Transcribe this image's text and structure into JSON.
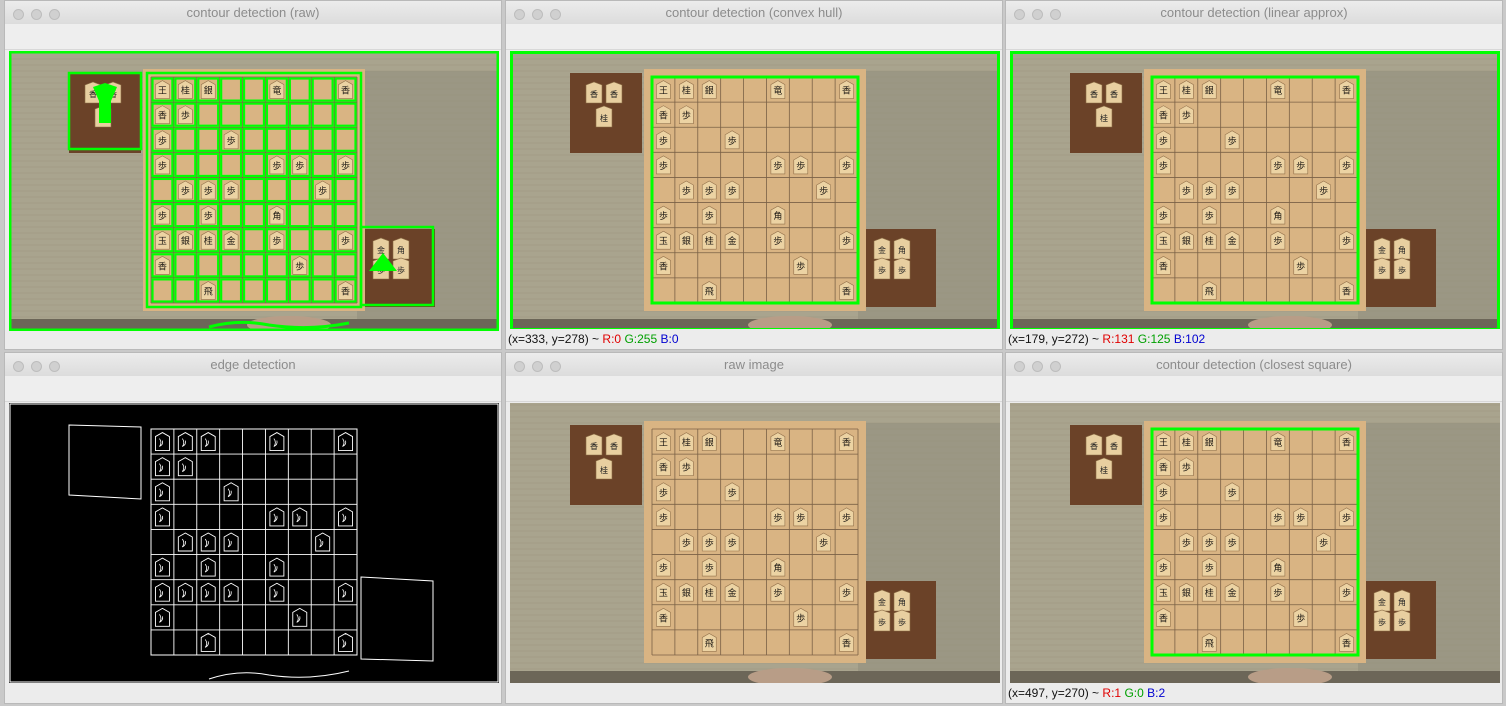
{
  "windows": {
    "raw_contour": {
      "title": "contour detection (raw)",
      "status": null
    },
    "convex_hull": {
      "title": "contour detection (convex hull)",
      "status": {
        "coords": "(x=333, y=278) ~",
        "r": "R:0",
        "g": "G:255",
        "b": "B:0"
      }
    },
    "linear_approx": {
      "title": "contour detection (linear approx)",
      "status": {
        "coords": "(x=179, y=272) ~",
        "r": "R:131",
        "g": "G:125",
        "b": "B:102"
      }
    },
    "edge": {
      "title": "edge detection",
      "status": null
    },
    "raw_image": {
      "title": "raw image",
      "status": null
    },
    "closest_square": {
      "title": "contour detection (closest square)",
      "status": {
        "coords": "(x=497, y=270) ~",
        "r": "R:1",
        "g": "G:0",
        "b": "B:2"
      }
    }
  },
  "board": {
    "pieces": [
      [
        "王",
        "桂",
        "銀",
        "",
        "",
        "竜",
        "",
        "",
        "香"
      ],
      [
        "香",
        "歩",
        "",
        "",
        "",
        "",
        "",
        "",
        ""
      ],
      [
        "歩",
        "",
        "",
        "歩",
        "",
        "",
        "",
        "",
        ""
      ],
      [
        "歩",
        "",
        "",
        "",
        "",
        "歩",
        "歩",
        "",
        "歩"
      ],
      [
        "",
        "歩",
        "歩",
        "歩",
        "",
        "",
        "",
        "歩",
        ""
      ],
      [
        "歩",
        "",
        "歩",
        "",
        "",
        "角",
        "",
        "",
        ""
      ],
      [
        "玉",
        "銀",
        "桂",
        "金",
        "",
        "歩",
        "",
        "",
        "歩"
      ],
      [
        "香",
        "",
        "",
        "",
        "",
        "",
        "歩",
        "",
        ""
      ],
      [
        "",
        "",
        "飛",
        "",
        "",
        "",
        "",
        "",
        "香"
      ]
    ],
    "left_stand": [
      "香",
      "香",
      "桂"
    ],
    "right_stand": [
      "金",
      "角",
      "歩",
      "歩"
    ]
  },
  "colors": {
    "contour_green": "#00ff00",
    "board_wood": "#d9b483",
    "background_tatami": "#a9a48e",
    "stand_wood": "#6b4228"
  }
}
